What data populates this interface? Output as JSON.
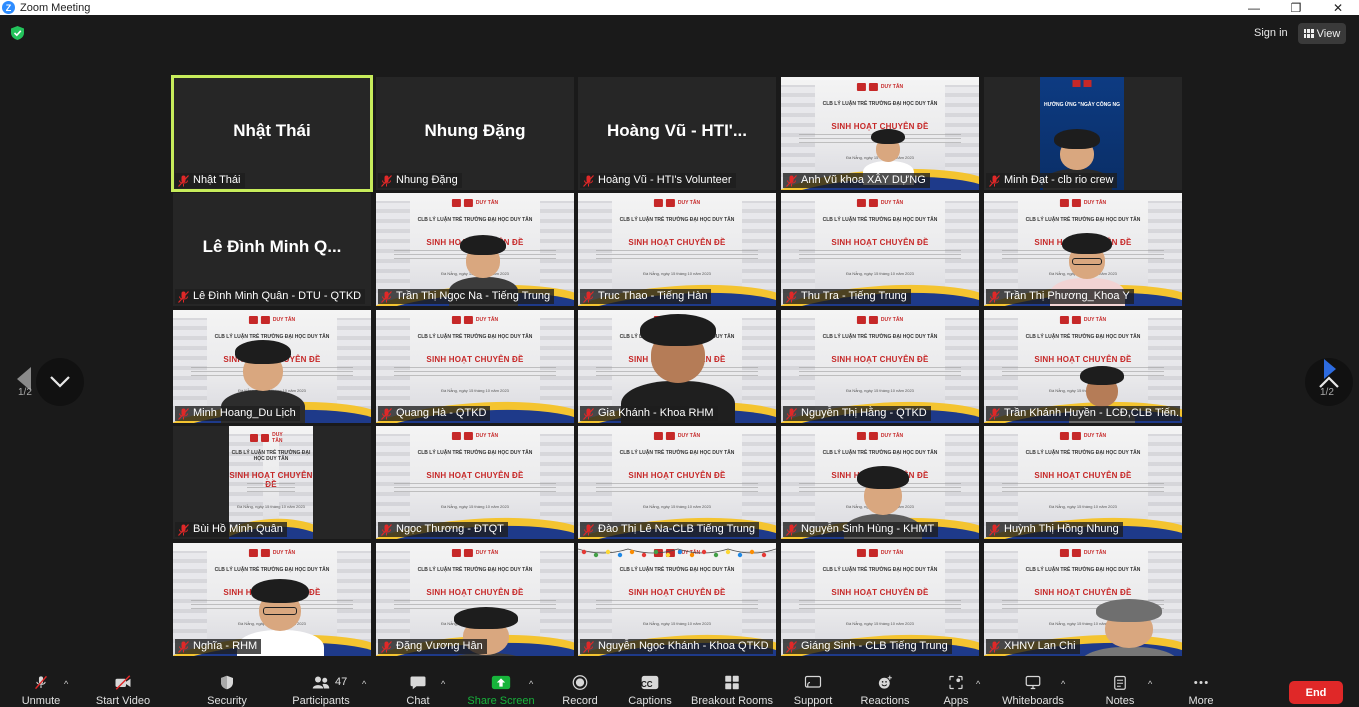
{
  "window": {
    "title": "Zoom Meeting",
    "controls": {
      "minimize": "—",
      "maximize": "❐",
      "close": "✕"
    }
  },
  "header": {
    "signin_label": "Sign in",
    "view_label": "View"
  },
  "pagination": {
    "left": "1/2",
    "right": "1/2"
  },
  "tiles": [
    {
      "label": "Nhật Thái",
      "big": "Nhật Thái",
      "kind": "name",
      "active": true
    },
    {
      "label": "Nhung Đặng",
      "big": "Nhung Đặng",
      "kind": "name"
    },
    {
      "label": "Hoàng Vũ - HTI's Volunteer",
      "big": "Hoàng Vũ - HTI'...",
      "kind": "name"
    },
    {
      "label": "Anh Vũ khoa XÂY DỰNG",
      "kind": "slide",
      "person": "small"
    },
    {
      "label": "Minh Đạt - clb rio crew",
      "kind": "blue",
      "banner": "HƯỞNG ỨNG \"NGÀY CÔNG NG"
    },
    {
      "label": "Lê Đình Minh Quân - DTU - QTKD",
      "big": "Lê Đình Minh Q...",
      "kind": "name"
    },
    {
      "label": "Trần Thị Ngọc Na - Tiếng Trung",
      "kind": "slide",
      "person": "f"
    },
    {
      "label": "Truc Thao - Tiếng Hàn",
      "kind": "slide"
    },
    {
      "label": "Thu Tra - Tiếng Trung",
      "kind": "slide"
    },
    {
      "label": "Trần Thị Phương_Khoa Y",
      "kind": "slide",
      "person": "g"
    },
    {
      "label": "Minh Hoang_Du Lịch",
      "kind": "slide",
      "person": "m1"
    },
    {
      "label": "Quang Hà - QTKD",
      "kind": "slide"
    },
    {
      "label": "Gia Khánh - Khoa RHM",
      "kind": "slide",
      "person": "big"
    },
    {
      "label": "Nguyễn Thị Hằng - QTKD",
      "kind": "slide"
    },
    {
      "label": "Trần Khánh Huyền - LCĐ,CLB Tiến...",
      "kind": "slide",
      "person": "fd"
    },
    {
      "label": "Bùi Hồ Minh Quân",
      "kind": "narrowslide"
    },
    {
      "label": "Ngọc Thương - ĐTQT",
      "kind": "slide"
    },
    {
      "label": "Đào Thị Lê Na-CLB Tiếng Trung",
      "kind": "slide"
    },
    {
      "label": "Nguyễn Sinh Hùng - KHMT",
      "kind": "slide",
      "person": "m2"
    },
    {
      "label": "Huỳnh Thị Hồng Nhung",
      "kind": "slide"
    },
    {
      "label": "Nghĩa - RHM",
      "kind": "slide",
      "person": "g2"
    },
    {
      "label": "Đặng Vương Hân",
      "kind": "slide",
      "person": "bottom"
    },
    {
      "label": "Nguyễn Ngọc Khánh - Khoa QTKD",
      "kind": "slide",
      "lights": true
    },
    {
      "label": "Giáng Sinh - CLB Tiếng Trung",
      "kind": "slide"
    },
    {
      "label": "XHNV Lan Chi",
      "kind": "slide",
      "person": "grayhair"
    }
  ],
  "slide_text": {
    "logo": "DUY TÂN",
    "line1": "CLB LÝ LUẬN TRẺ TRƯỜNG ĐẠI HỌC DUY TÂN",
    "line2": "SINH HOẠT CHUYÊN ĐỀ",
    "line4": "Đà Nẵng, ngày 15 tháng 10 năm 2023"
  },
  "toolbar": {
    "unmute": "Unmute",
    "start_video": "Start Video",
    "security": "Security",
    "participants": "Participants",
    "participants_count": "47",
    "chat": "Chat",
    "share_screen": "Share Screen",
    "record": "Record",
    "captions": "Captions",
    "captions_icon_text": "CC",
    "breakout_rooms": "Breakout Rooms",
    "support": "Support",
    "reactions": "Reactions",
    "apps": "Apps",
    "whiteboards": "Whiteboards",
    "notes": "Notes",
    "more": "More",
    "end": "End",
    "caret": "^"
  },
  "colors": {
    "active_speaker": "#c7ec5b",
    "share_green": "#17b43b",
    "end_red": "#e02828",
    "zoom_blue": "#2d8cff",
    "slide_red": "#c62828",
    "slide_navy": "#1e3a8a",
    "slide_yellow": "#f4c430"
  },
  "icons": {
    "mic_muted": "mic-muted-icon",
    "video_off": "video-off-icon",
    "security": "shield-icon",
    "participants": "people-icon",
    "chat": "chat-bubble-icon",
    "share": "share-arrow-icon",
    "record": "record-icon",
    "breakout": "grid-icon",
    "support": "support-icon",
    "reactions": "smiley-icon",
    "apps": "apps-icon",
    "whiteboards": "whiteboard-icon",
    "notes": "notes-icon",
    "more": "ellipsis-icon"
  }
}
